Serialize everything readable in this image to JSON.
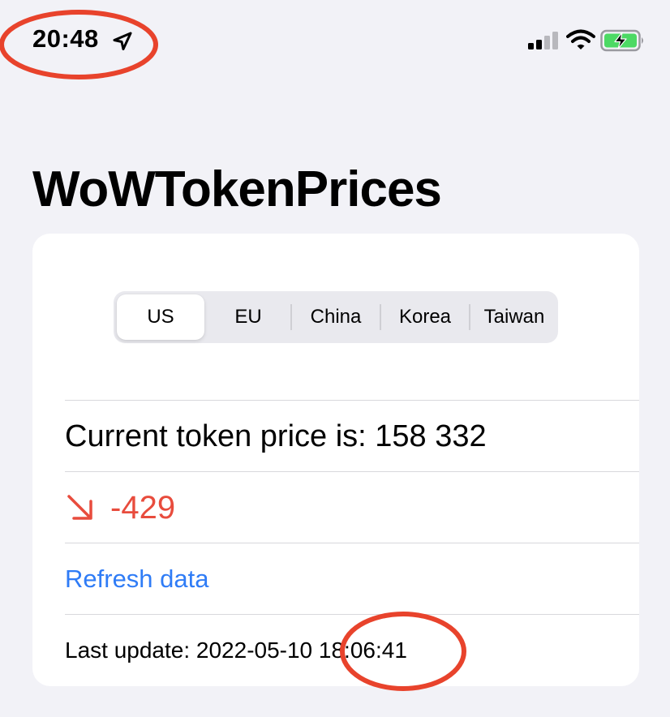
{
  "status_bar": {
    "time": "20:48",
    "icons": [
      "location-arrow-icon",
      "cellular-signal-icon",
      "wifi-icon",
      "battery-charging-icon"
    ]
  },
  "title": "WoWTokenPrices",
  "regions": {
    "selected": "US",
    "options": [
      "US",
      "EU",
      "China",
      "Korea",
      "Taiwan"
    ]
  },
  "price": {
    "text": "Current token price is: 158 332"
  },
  "change": {
    "icon": "arrow-down-right-icon",
    "value": "-429"
  },
  "refresh": {
    "label": "Refresh data"
  },
  "last_update": {
    "text": "Last update: 2022-05-10 18:06:41"
  },
  "colors": {
    "background": "#f2f2f7",
    "card": "#ffffff",
    "negative": "#e84c3d",
    "link": "#2f7cf6",
    "annotation": "#e8432c",
    "battery": "#4cd964"
  }
}
